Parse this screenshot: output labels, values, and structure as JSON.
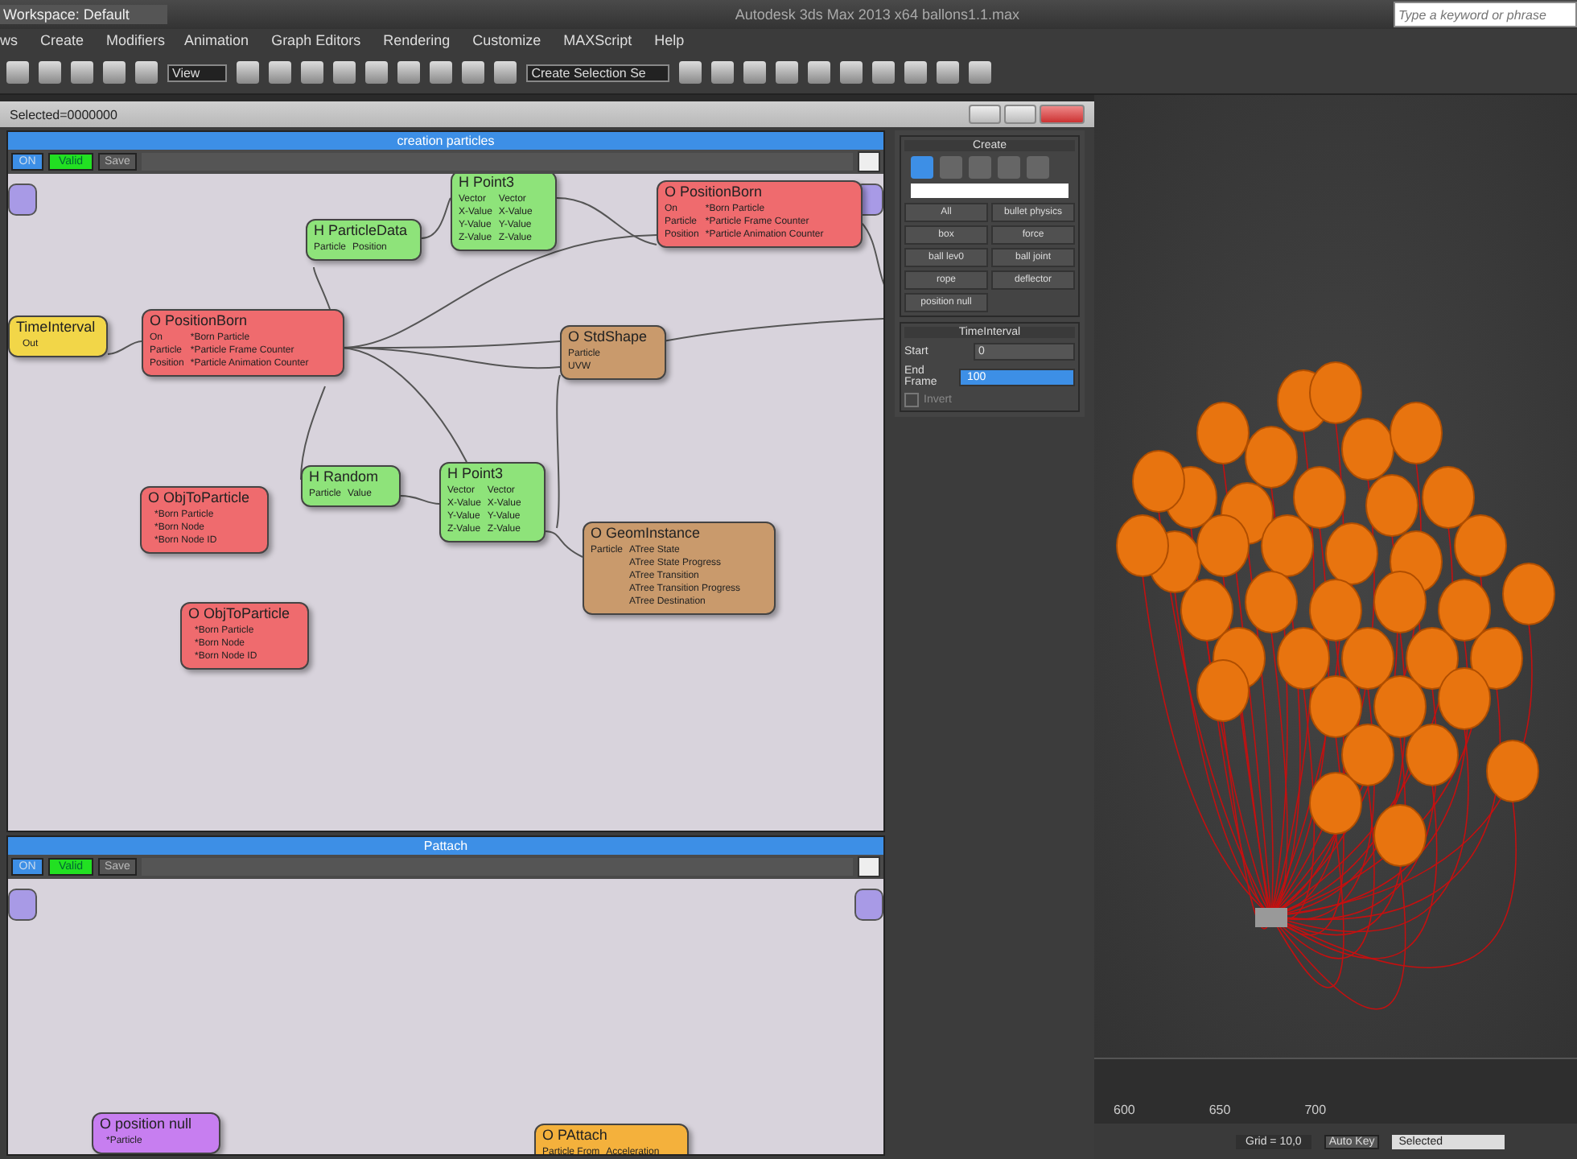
{
  "app": {
    "workspace": "Workspace: Default",
    "title": "Autodesk 3ds Max  2013 x64      ballons1.1.max",
    "search": {
      "placeholder": "Type a keyword or phrase"
    }
  },
  "menu": [
    "ws",
    "Create",
    "Modifiers",
    "Animation",
    "Graph Editors",
    "Rendering",
    "Customize",
    "MAXScript",
    "Help"
  ],
  "toolbar": {
    "view_dropdown": "View",
    "selection_set": "Create Selection Se"
  },
  "editor": {
    "title": "Selected=0000000",
    "panels": [
      {
        "title": "creation particles",
        "on": "ON",
        "valid": "Valid",
        "save": "Save",
        "nodes": [
          {
            "title": "H Point3",
            "color": "#8ee37a",
            "inputs": [
              "Vector",
              "X-Value",
              "Y-Value",
              "Z-Value"
            ],
            "outputs": [
              "Vector",
              "X-Value",
              "Y-Value",
              "Z-Value"
            ]
          },
          {
            "title": "H ParticleData",
            "color": "#8ee37a",
            "inputs": [
              "Particle"
            ],
            "outputs": [
              "Position"
            ]
          },
          {
            "title": "O PositionBorn",
            "color": "#ef6b6e",
            "inputs": [
              "On",
              "Particle",
              "Position"
            ],
            "outputs": [
              "*Born Particle",
              "*Particle Frame Counter",
              "*Particle Animation Counter"
            ]
          },
          {
            "title": "TimeInterval",
            "color": "#f2d648",
            "outputs": [
              "Out"
            ]
          },
          {
            "title": "O PositionBorn",
            "color": "#ef6b6e",
            "inputs": [
              "On",
              "Particle",
              "Position"
            ],
            "outputs": [
              "*Born Particle",
              "*Particle Frame Counter",
              "*Particle Animation Counter"
            ]
          },
          {
            "title": "O StdShape",
            "color": "#c99a6c",
            "inputs": [
              "Particle",
              "UVW"
            ]
          },
          {
            "title": "O ObjToParticle",
            "color": "#ef6b6e",
            "outputs": [
              "*Born Particle",
              "*Born Node",
              "*Born Node ID"
            ]
          },
          {
            "title": "H Random",
            "color": "#8ee37a",
            "inputs": [
              "Particle"
            ],
            "outputs": [
              "Value"
            ]
          },
          {
            "title": "H Point3",
            "color": "#8ee37a",
            "inputs": [
              "Vector",
              "X-Value",
              "Y-Value",
              "Z-Value"
            ],
            "outputs": [
              "Vector",
              "X-Value",
              "Y-Value",
              "Z-Value"
            ]
          },
          {
            "title": "O GeomInstance",
            "color": "#c99a6c",
            "inputs": [
              "Particle"
            ],
            "outputs": [
              "ATree State",
              "ATree State Progress",
              "ATree Transition",
              "ATree Transition Progress",
              "ATree Destination"
            ]
          },
          {
            "title": "O ObjToParticle",
            "color": "#ef6b6e",
            "outputs": [
              "*Born Particle",
              "*Born Node",
              "*Born Node ID"
            ]
          }
        ]
      },
      {
        "title": "Pattach",
        "on": "ON",
        "valid": "Valid",
        "save": "Save",
        "nodes": [
          {
            "title": "O position null",
            "color": "#c77ef0",
            "outputs": [
              "*Particle"
            ]
          },
          {
            "title": "O PAttach",
            "color": "#f4b13c",
            "inputs": [
              "Particle From"
            ],
            "outputs": [
              "Acceleration"
            ]
          }
        ]
      }
    ]
  },
  "command_panel": {
    "heading": "Create",
    "buttons": [
      "All",
      "bullet physics",
      "box",
      "force",
      "ball lev0",
      "ball joint",
      "rope",
      "deflector",
      "position null"
    ],
    "section": "TimeInterval",
    "fields": [
      {
        "label": "Start",
        "value": "0",
        "selected": false
      },
      {
        "label": "End Frame",
        "value": "100",
        "selected": true
      }
    ],
    "invert": {
      "label": "Invert",
      "checked": false
    }
  },
  "timeline": {
    "ticks": [
      "600",
      "650",
      "700"
    ]
  },
  "status": {
    "grid": "Grid = 10,0",
    "auto_key": "Auto Key",
    "key_mode": "Selected"
  }
}
